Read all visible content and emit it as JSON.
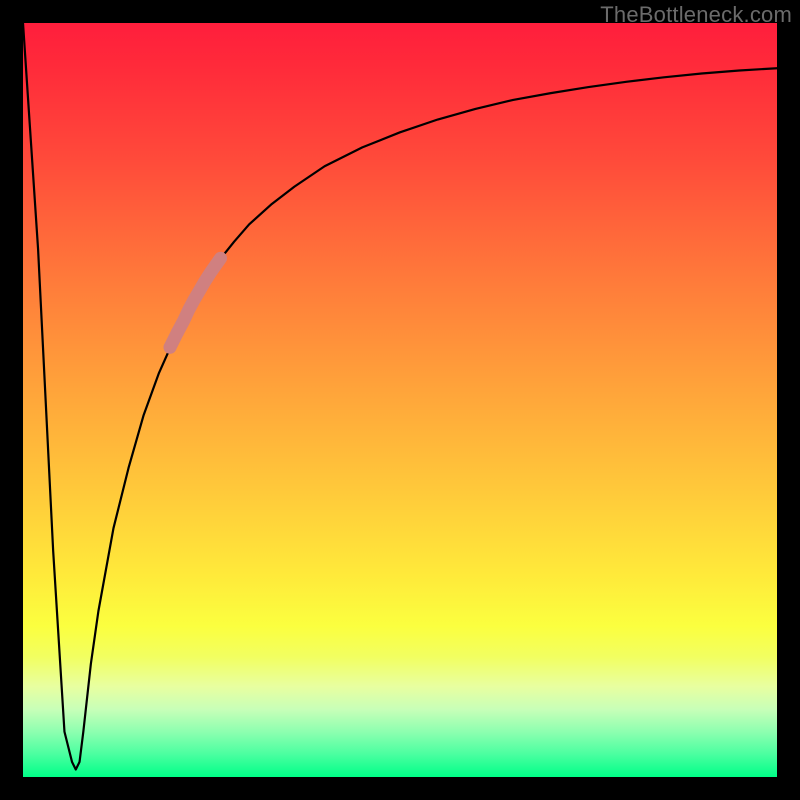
{
  "watermark": "TheBottleneck.com",
  "colors": {
    "frame": "#000000",
    "curve_stroke": "#000000",
    "marker_fill": "#d08080",
    "gradient_top": "#ff1e3c",
    "gradient_bottom": "#00ff88"
  },
  "chart_data": {
    "type": "line",
    "title": "",
    "xlabel": "",
    "ylabel": "",
    "xlim": [
      0,
      100
    ],
    "ylim": [
      0,
      100
    ],
    "x": [
      0,
      2,
      4,
      5.5,
      6.5,
      7,
      7.5,
      8,
      9,
      10,
      12,
      14,
      16,
      18,
      20,
      22,
      24,
      26,
      28,
      30,
      33,
      36,
      40,
      45,
      50,
      55,
      60,
      65,
      70,
      75,
      80,
      85,
      90,
      95,
      100
    ],
    "y": [
      100,
      70,
      30,
      6,
      2,
      1,
      2,
      6,
      15,
      22,
      33,
      41,
      48,
      53.5,
      58,
      62,
      65.5,
      68.5,
      71,
      73.3,
      76,
      78.3,
      81,
      83.5,
      85.5,
      87.2,
      88.6,
      89.8,
      90.7,
      91.5,
      92.2,
      92.8,
      93.3,
      93.7,
      94
    ],
    "series": [
      {
        "name": "bottleneck-curve",
        "note": "x and y above"
      }
    ],
    "markers": {
      "name": "highlighted-range",
      "color": "#d08080",
      "points": [
        {
          "x": 19.5,
          "y": 57
        },
        {
          "x": 20.5,
          "y": 59
        },
        {
          "x": 21.3,
          "y": 60.5
        },
        {
          "x": 22,
          "y": 62
        },
        {
          "x": 22.7,
          "y": 63.3
        },
        {
          "x": 23.4,
          "y": 64.5
        },
        {
          "x": 24.1,
          "y": 65.7
        },
        {
          "x": 24.8,
          "y": 66.8
        },
        {
          "x": 25.5,
          "y": 67.8
        },
        {
          "x": 26.2,
          "y": 68.8
        }
      ]
    }
  }
}
